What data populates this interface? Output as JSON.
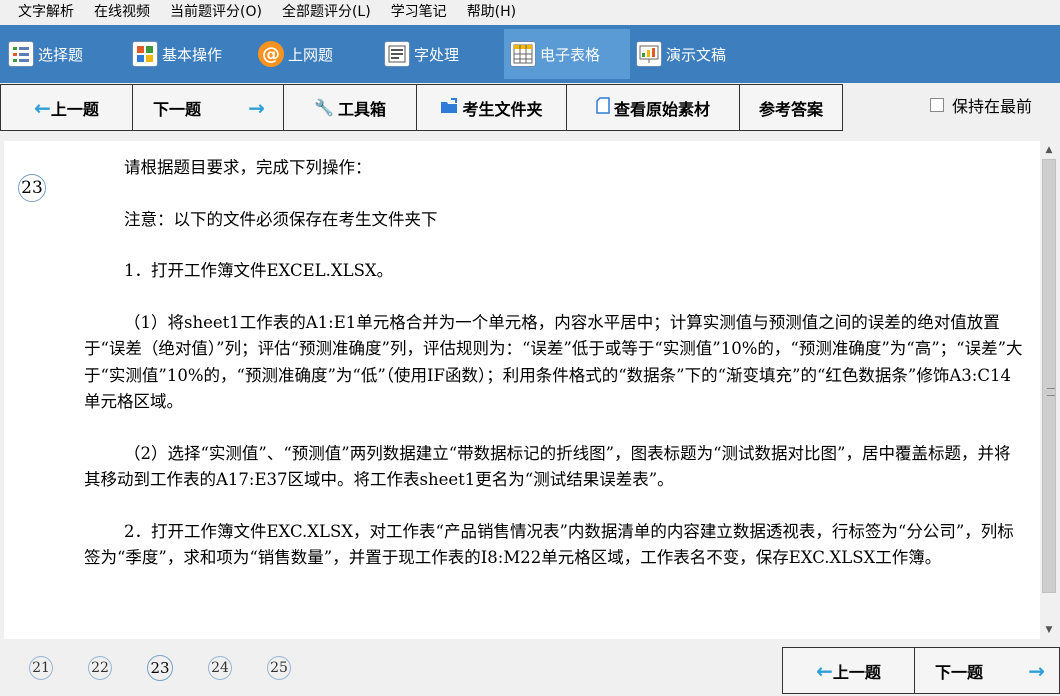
{
  "menu": [
    "文字解析",
    "在线视频",
    "当前题评分(O)",
    "全部题评分(L)",
    "学习笔记",
    "帮助(H)"
  ],
  "categories": [
    {
      "label": "选择题",
      "icon": "list-icon"
    },
    {
      "label": "基本操作",
      "icon": "grid-icon"
    },
    {
      "label": "上网题",
      "icon": "at-icon"
    },
    {
      "label": "字处理",
      "icon": "document-icon"
    },
    {
      "label": "电子表格",
      "icon": "spreadsheet-icon",
      "active": true
    },
    {
      "label": "演示文稿",
      "icon": "presentation-icon"
    }
  ],
  "toolbar": {
    "prev": "上一题",
    "next": "下一题",
    "tools": "工具箱",
    "folder": "考生文件夹",
    "source": "查看原始素材",
    "answer": "参考答案",
    "keep_on_top": "保持在最前",
    "keep_on_top_checked": false
  },
  "question": {
    "number": "23",
    "lines": [
      "请根据题目要求，完成下列操作：",
      "注意：以下的文件必须保存在考生文件夹下",
      "1．打开工作簿文件EXCEL.XLSX。",
      "（1）将sheet1工作表的A1:E1单元格合并为一个单元格，内容水平居中；计算实测值与预测值之间的误差的绝对值放置于“误差（绝对值）”列；评估“预测准确度”列，评估规则为：“误差”低于或等于“实测值”10%的，“预测准确度”为“高”；“误差”大于“实测值”10%的，“预测准确度”为“低”（使用IF函数）；利用条件格式的“数据条”下的“渐变填充”的“红色数据条”修饰A3:C14单元格区域。",
      "（2）选择“实测值”、“预测值”两列数据建立“带数据标记的折线图”，图表标题为“测试数据对比图”，居中覆盖标题，并将其移动到工作表的A17:E37区域中。将工作表sheet1更名为“测试结果误差表”。",
      "2．打开工作簿文件EXC.XLSX，对工作表“产品销售情况表”内数据清单的内容建立数据透视表，行标签为“分公司”，列标签为“季度”，求和项为“销售数量”，并置于现工作表的I8:M22单元格区域，工作表名不变，保存EXC.XLSX工作簿。"
    ]
  },
  "pager": {
    "pages": [
      "21",
      "22",
      "23",
      "24",
      "25"
    ],
    "current": "23",
    "prev": "上一题",
    "next": "下一题"
  }
}
